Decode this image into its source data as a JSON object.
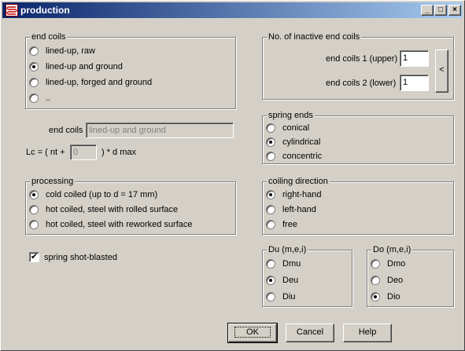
{
  "window": {
    "title": "production",
    "controls": {
      "minimize": "_",
      "maximize": "□",
      "close": "×"
    }
  },
  "end_coils_group": {
    "title": "end coils",
    "options": [
      "lined-up, raw",
      "lined-up and ground",
      "lined-up, forged and ground",
      ".."
    ],
    "selected": "lined-up and ground"
  },
  "end_coils_field": {
    "label": "end coils",
    "value": "lined-up and ground"
  },
  "lc_formula": {
    "prefix": "Lc = ( nt +",
    "value": "0",
    "suffix": ") * d max"
  },
  "processing_group": {
    "title": "processing",
    "options": [
      "cold coiled (up to d = 17 mm)",
      "hot coiled, steel with rolled surface",
      "hot coiled, steel with reworked surface"
    ],
    "selected": "cold coiled (up to d = 17 mm)"
  },
  "shot_blasted": {
    "label": "spring shot-blasted",
    "checked": true,
    "mark": "✔"
  },
  "inactive_group": {
    "title": "No. of inactive end coils",
    "upper_label": "end coils 1 (upper)",
    "upper_value": "1",
    "lower_label": "end coils 2 (lower)",
    "lower_value": "1",
    "arrow_button": "<"
  },
  "spring_ends_group": {
    "title": "spring ends",
    "options": [
      "conical",
      "cylindrical",
      "concentric"
    ],
    "selected": "cylindrical"
  },
  "coiling_group": {
    "title": "coiling direction",
    "options": [
      "right-hand",
      "left-hand",
      "free"
    ],
    "selected": "right-hand"
  },
  "du_group": {
    "title": "Du (m,e,i)",
    "options": [
      "Dmu",
      "Deu",
      "Diu"
    ],
    "selected": "Deu"
  },
  "do_group": {
    "title": "Do (m,e,i)",
    "options": [
      "Dmo",
      "Deo",
      "Dio"
    ],
    "selected": "Dio"
  },
  "buttons": {
    "ok": "OK",
    "cancel": "Cancel",
    "help": "Help"
  }
}
